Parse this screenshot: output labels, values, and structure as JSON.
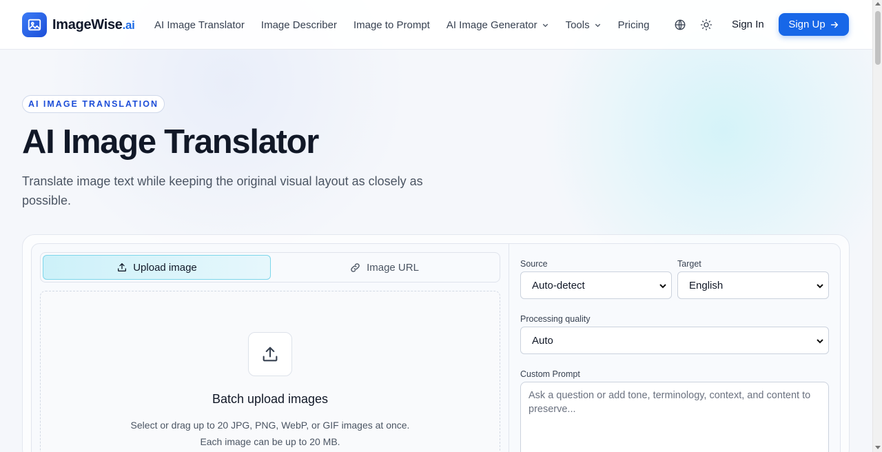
{
  "header": {
    "logo_name": "ImageWise",
    "logo_suffix": ".ai",
    "nav": [
      {
        "label": "AI Image Translator",
        "dropdown": false
      },
      {
        "label": "Image Describer",
        "dropdown": false
      },
      {
        "label": "Image to Prompt",
        "dropdown": false
      },
      {
        "label": "AI Image Generator",
        "dropdown": true
      },
      {
        "label": "Tools",
        "dropdown": true
      },
      {
        "label": "Pricing",
        "dropdown": false
      }
    ],
    "icons": [
      "globe-icon",
      "sun-icon"
    ],
    "sign_in": "Sign In",
    "sign_up": "Sign Up"
  },
  "hero": {
    "badge": "AI IMAGE TRANSLATION",
    "title": "AI Image Translator",
    "subtitle": "Translate image text while keeping the original visual layout as closely as possible."
  },
  "tool": {
    "tabs": [
      {
        "label": "Upload image",
        "icon": "upload-icon",
        "active": true
      },
      {
        "label": "Image URL",
        "icon": "link-icon",
        "active": false
      }
    ],
    "dropzone": {
      "title": "Batch upload images",
      "line1": "Select or drag up to 20 JPG, PNG, WebP, or GIF images at once.",
      "line2": "Each image can be up to 20 MB."
    },
    "source_label": "Source",
    "source_value": "Auto-detect",
    "target_label": "Target",
    "target_value": "English",
    "quality_label": "Processing quality",
    "quality_value": "Auto",
    "prompt_label": "Custom Prompt",
    "prompt_placeholder": "Ask a question or add tone, terminology, context, and content to preserve..."
  },
  "colors": {
    "accent": "#1767e8",
    "tab_active_border": "#7dd6ea",
    "badge_text": "#1d4ed8"
  }
}
